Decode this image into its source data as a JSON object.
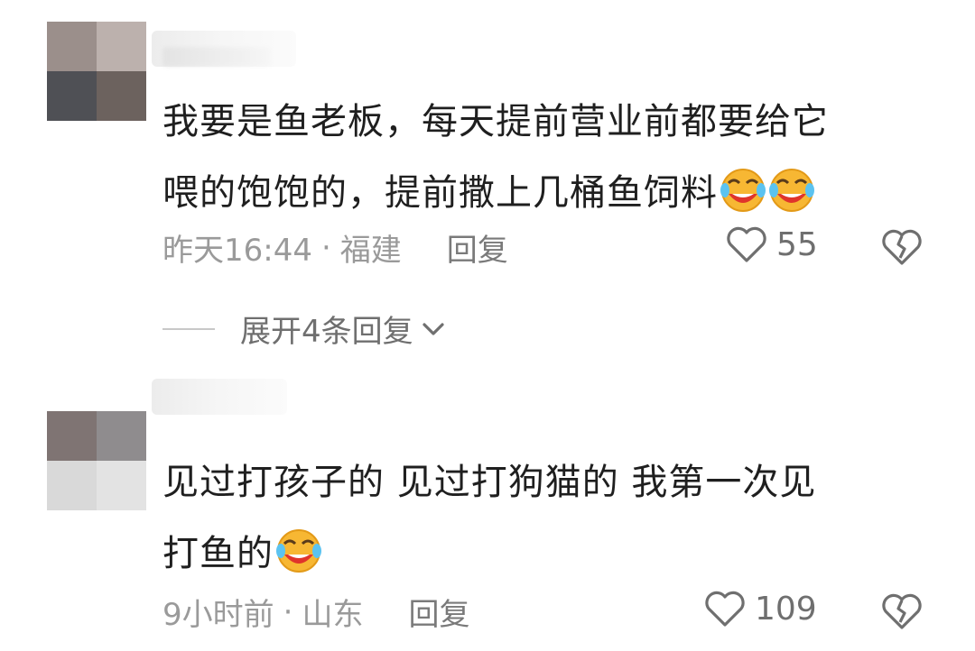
{
  "comments": [
    {
      "text_line1": "我要是鱼老板，每天提前营业前都要给它",
      "text_line2": "喂的饱饱的，提前撒上几桶鱼饲料",
      "time": "昨天16:44",
      "separator": "·",
      "location": "福建",
      "reply_label": "回复",
      "likes": "55",
      "expand_label": "展开4条回复",
      "emoji": "laughing-crying-emoji"
    },
    {
      "text_line1": "见过打孩子的  见过打狗猫的  我第一次见",
      "text_line2": "打鱼的",
      "time": "9小时前",
      "separator": "·",
      "location": "山东",
      "reply_label": "回复",
      "likes": "109",
      "emoji": "laughing-crying-emoji"
    }
  ],
  "colors": {
    "text": "#1f1f1f",
    "meta": "#9a9a9a",
    "icon": "#6f6f6f",
    "background": "#ffffff"
  }
}
